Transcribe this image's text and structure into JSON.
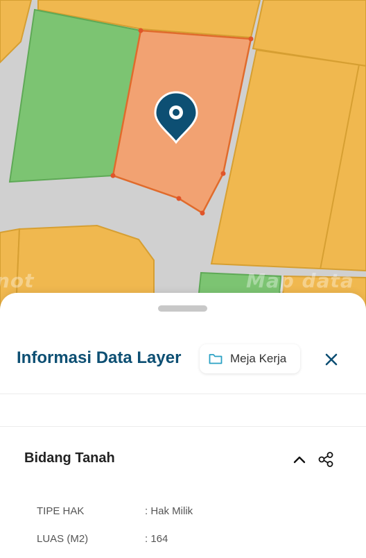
{
  "map": {
    "watermark_left": "not",
    "watermark_right": "Map data",
    "colors": {
      "road": "#d0d0d0",
      "parcel_orange": "#f0b84f",
      "parcel_green": "#7cc472",
      "selected_parcel": "#f2a272",
      "pin": "#0d4f73"
    },
    "pin_icon": "location-pin-icon"
  },
  "panel": {
    "title": "Informasi Data Layer",
    "workspace_button_label": "Meja Kerja",
    "workspace_icon": "folder-icon",
    "close_icon": "close-icon"
  },
  "section": {
    "title": "Bidang Tanah",
    "collapse_icon": "chevron-up-icon",
    "share_icon": "share-icon",
    "attributes": [
      {
        "label": "TIPE HAK",
        "value": ": Hak Milik"
      },
      {
        "label": "LUAS (M2)",
        "value": ": 164"
      }
    ]
  }
}
